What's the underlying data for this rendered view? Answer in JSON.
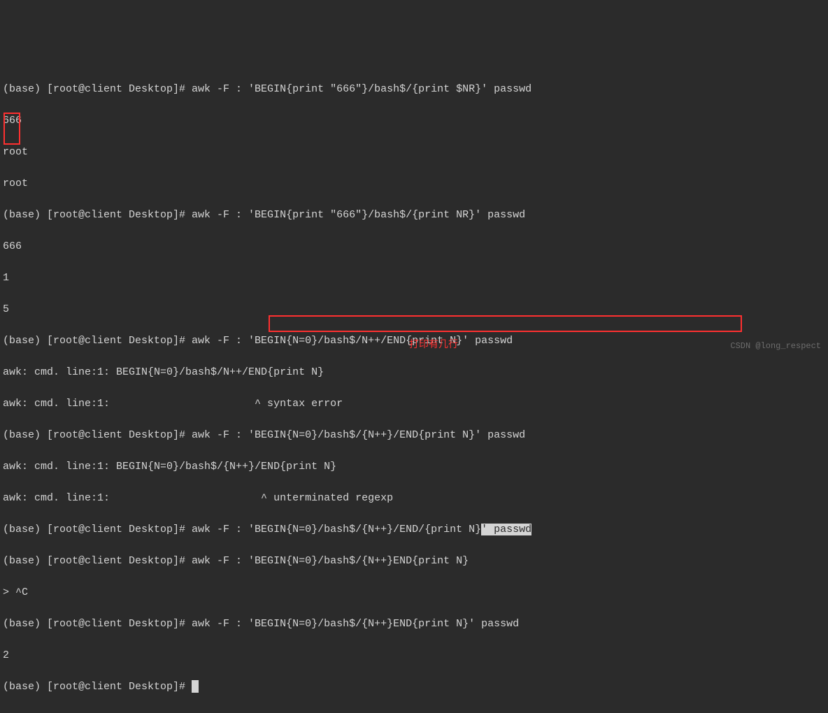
{
  "prompt": "(base) [root@client Desktop]# ",
  "lines": {
    "l1": "(base) [root@client Desktop]# awk -F : 'BEGIN{print \"666\"}/bash$/{print $NR}' passwd",
    "l2": "666",
    "l3": "root",
    "l4": "root",
    "l5": "(base) [root@client Desktop]# awk -F : 'BEGIN{print \"666\"}/bash$/{print NR}' passwd",
    "l6": "666",
    "l7": "1",
    "l8": "5",
    "l9": "(base) [root@client Desktop]# awk -F : 'BEGIN{N=0}/bash$/N++/END{print N}' passwd",
    "l10": "awk: cmd. line:1: BEGIN{N=0}/bash$/N++/END{print N}",
    "l11": "awk: cmd. line:1:                       ^ syntax error",
    "l12": "(base) [root@client Desktop]# awk -F : 'BEGIN{N=0}/bash$/{N++}/END{print N}' passwd",
    "l13": "awk: cmd. line:1: BEGIN{N=0}/bash$/{N++}/END{print N}",
    "l14": "awk: cmd. line:1:                        ^ unterminated regexp",
    "l15a": "(base) [root@client Desktop]# awk -F : 'BEGIN{N=0}/bash$/{N++}/END/{print N}",
    "l15b": "' passwd",
    "l16": "(base) [root@client Desktop]# awk -F : 'BEGIN{N=0}/bash$/{N++}END{print N}",
    "l17": "> ^C",
    "l18": "(base) [root@client Desktop]# awk -F : 'BEGIN{N=0}/bash$/{N++}END{print N}' passwd",
    "l19": "2",
    "l20": "(base) [root@client Desktop]# "
  },
  "annotation": "打印有几行",
  "watermark": "CSDN @long_respect"
}
